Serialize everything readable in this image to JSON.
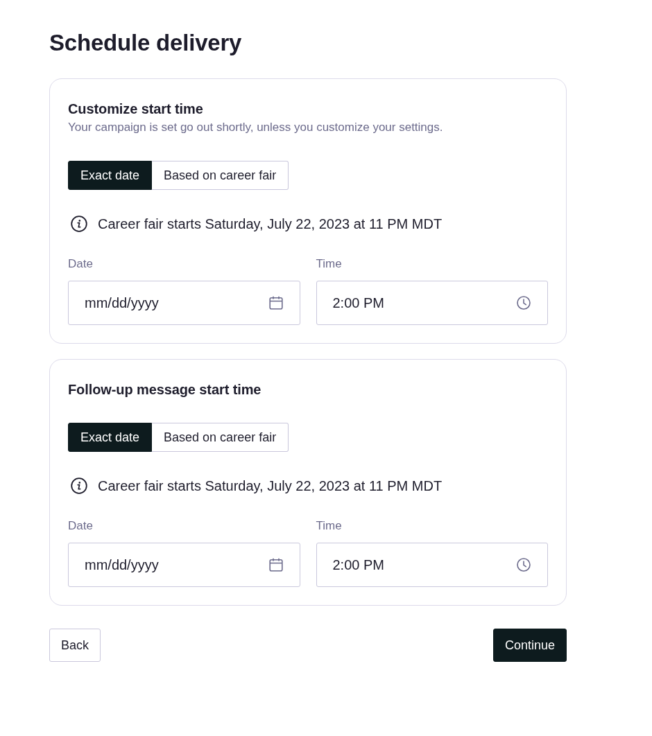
{
  "page": {
    "title": "Schedule delivery"
  },
  "sections": [
    {
      "heading": "Customize start time",
      "description": "Your campaign is set go out shortly, unless you customize your settings.",
      "options": [
        {
          "label": "Exact date",
          "selected": true
        },
        {
          "label": "Based on career fair",
          "selected": false
        }
      ],
      "info": "Career fair starts Saturday, July 22, 2023 at 11 PM MDT",
      "date": {
        "label": "Date",
        "placeholder": "mm/dd/yyyy"
      },
      "time": {
        "label": "Time",
        "value": "2:00 PM"
      }
    },
    {
      "heading": "Follow-up message start time",
      "options": [
        {
          "label": "Exact date",
          "selected": true
        },
        {
          "label": "Based on career fair",
          "selected": false
        }
      ],
      "info": "Career fair starts Saturday, July 22, 2023 at 11 PM MDT",
      "date": {
        "label": "Date",
        "placeholder": "mm/dd/yyyy"
      },
      "time": {
        "label": "Time",
        "value": "2:00 PM"
      }
    }
  ],
  "buttons": [
    {
      "label": "Back",
      "kind": "secondary"
    },
    {
      "label": "Continue",
      "kind": "primary"
    }
  ]
}
